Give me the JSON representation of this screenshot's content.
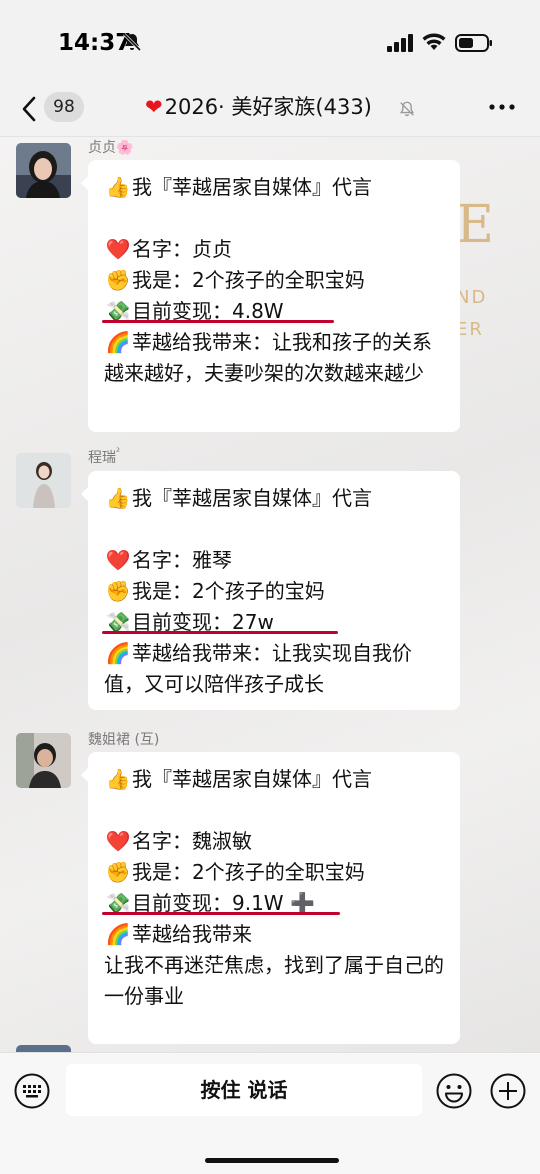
{
  "status_bar": {
    "time": "14:37"
  },
  "header": {
    "unread_count": "98",
    "title": "2026· 美好家族(433)"
  },
  "messages": [
    {
      "sender": "贞贞",
      "lines": [
        {
          "icon": "👍",
          "text": "我『莘越居家自媒体』代言"
        },
        {
          "icon": "",
          "text": ""
        },
        {
          "icon": "❤️",
          "text": "名字：贞贞"
        },
        {
          "icon": "✊",
          "text": "我是：2个孩子的全职宝妈"
        },
        {
          "icon": "💸",
          "text": "目前变现：4.8W"
        },
        {
          "icon": "🌈",
          "text": "莘越给我带来：让我和孩子的关系越来越好，夫妻吵架的次数越来越少"
        }
      ]
    },
    {
      "sender": "程瑞",
      "sender_suffix": "²",
      "lines": [
        {
          "icon": "👍",
          "text": "我『莘越居家自媒体』代言"
        },
        {
          "icon": "",
          "text": ""
        },
        {
          "icon": "❤️",
          "text": "名字：雅琴"
        },
        {
          "icon": "✊",
          "text": "我是：2个孩子的宝妈"
        },
        {
          "icon": "💸",
          "text": "目前变现：27w"
        },
        {
          "icon": "🌈",
          "text": "莘越给我带来：让我实现自我价值，又可以陪伴孩子成长"
        }
      ]
    },
    {
      "sender": "魏姐裙 (互)",
      "lines": [
        {
          "icon": "👍",
          "text": "我『莘越居家自媒体』代言"
        },
        {
          "icon": "",
          "text": ""
        },
        {
          "icon": "❤️",
          "text": "名字：魏淑敏"
        },
        {
          "icon": "✊",
          "text": "我是：2个孩子的全职宝妈"
        },
        {
          "icon": "💸",
          "text": "目前变现：9.1W ➕"
        },
        {
          "icon": "🌈",
          "text": "莘越给我带来"
        },
        {
          "icon": "",
          "text": "让我不再迷茫焦虑，找到了属于自己的一份事业"
        }
      ]
    }
  ],
  "background_text": {
    "letter": "E",
    "line1": "ND",
    "line2": "ER"
  },
  "input_bar": {
    "talk_label": "按住 说话"
  },
  "colors": {
    "accent_underline": "#c1002e",
    "heart": "#e5161f",
    "bubble": "#ffffff"
  }
}
